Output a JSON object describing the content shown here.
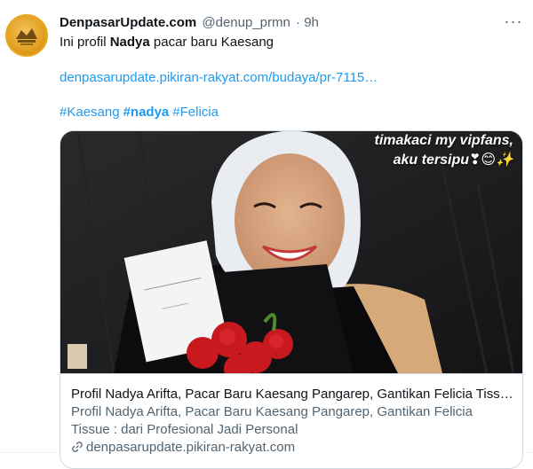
{
  "tweet": {
    "author": {
      "display_name": "DenpasarUpdate.com",
      "handle": "@denup_prmn",
      "separator": "·",
      "time": "9h",
      "avatar_icon": "denpasar-update-logo"
    },
    "more_button_label": "···",
    "text": {
      "prefix": "Ini profil ",
      "bold": "Nadya",
      "suffix": " pacar baru Kaesang"
    },
    "link": "denpasarupdate.pikiran-rakyat.com/budaya/pr-7115…",
    "hashtags": [
      "#Kaesang",
      "#nadya",
      "#Felicia"
    ]
  },
  "card": {
    "image_caption_line1": "timakaci my vipfans,",
    "image_caption_line2": "aku tersipu",
    "image_caption_emoji": "❣😊✨",
    "title": "Profil Nadya Arifta, Pacar Baru Kaesang Pangarep, Gantikan Felicia Tiss…",
    "description": "Profil Nadya Arifta, Pacar Baru Kaesang Pangarep, Gantikan Felicia Tissue : dari Profesional Jadi Personal",
    "domain": "denpasarupdate.pikiran-rakyat.com",
    "domain_icon": "link-icon"
  },
  "colors": {
    "link": "#1d9bf0",
    "text": "#0f1419",
    "secondary": "#536471",
    "border": "#cfd9de",
    "avatar": "#e2a021"
  }
}
